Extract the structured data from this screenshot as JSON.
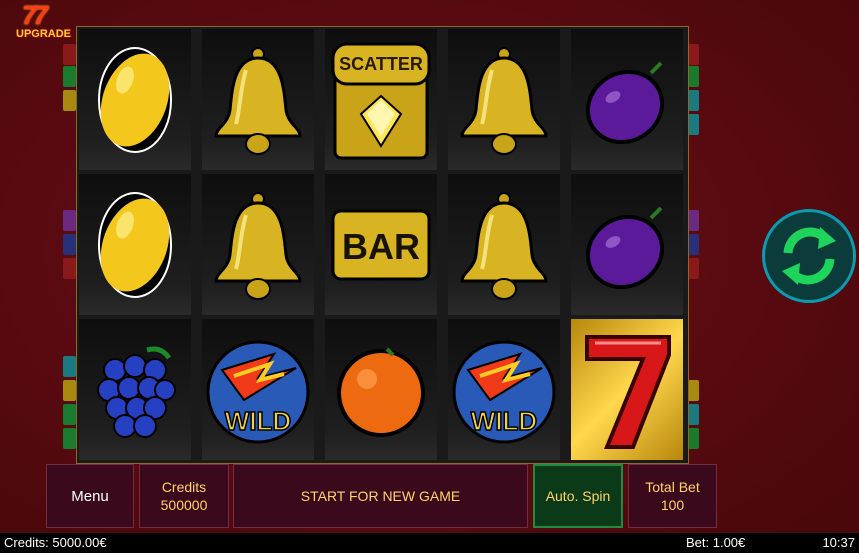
{
  "logo": {
    "text": "UPGRADE",
    "small": "",
    "sevens": "77"
  },
  "reels": [
    [
      "lemon",
      "lemon",
      "grapes"
    ],
    [
      "bell",
      "bell",
      "wild"
    ],
    [
      "scatter",
      "bar",
      "orange"
    ],
    [
      "bell",
      "bell",
      "wild"
    ],
    [
      "plum",
      "plum",
      "seven"
    ]
  ],
  "symbols": {
    "scatter_label": "SCATTER",
    "bar_label": "BAR",
    "wild_label": "WILD"
  },
  "controls": {
    "menu_label": "Menu",
    "credits_label": "Credits",
    "credits_value": "500000",
    "start_label": "START FOR NEW GAME",
    "autospin_label": "Auto. Spin",
    "totalbet_label": "Total Bet",
    "totalbet_value": "100"
  },
  "status": {
    "credits": "Credits: 5000.00€",
    "bet": "Bet: 1.00€",
    "time": "10:37"
  },
  "icons": {
    "spin": "refresh-arrows-icon"
  },
  "colors": {
    "accent": "#ffd36a",
    "spin_green": "#1fd45a",
    "background": "#5a0a10"
  }
}
